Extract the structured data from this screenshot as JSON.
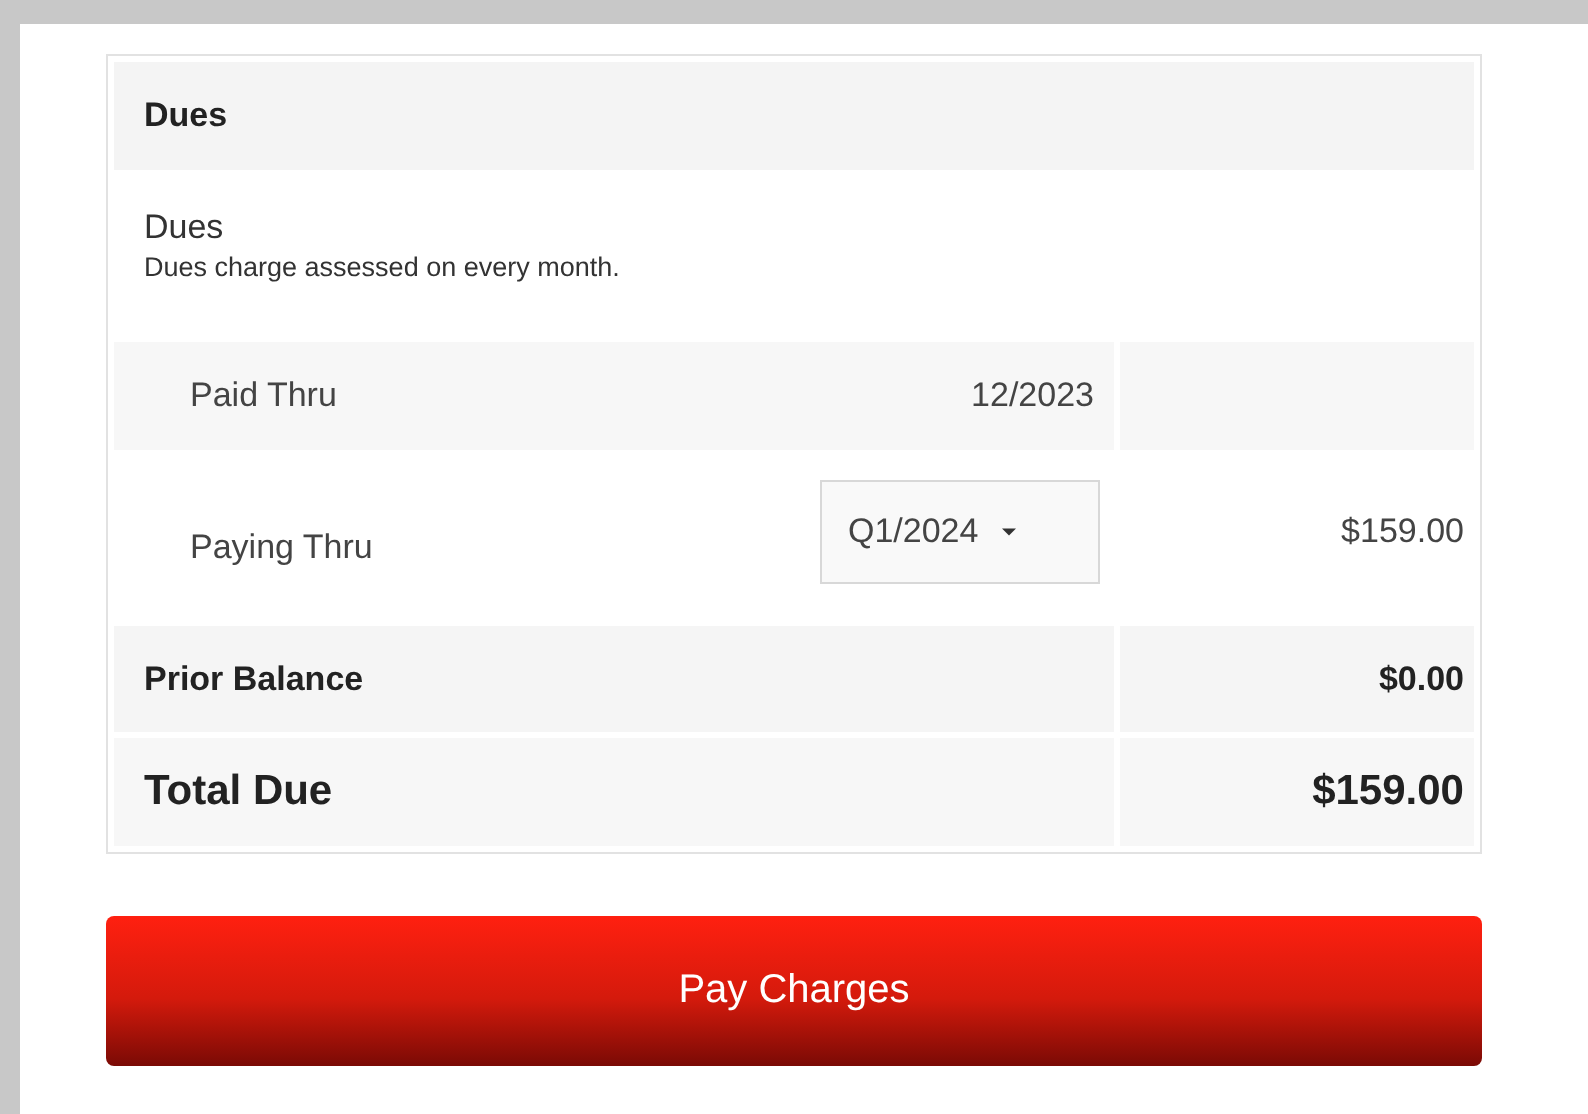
{
  "section": {
    "title": "Dues"
  },
  "charge": {
    "name": "Dues",
    "description": "Dues charge assessed on every month."
  },
  "rows": [
    {
      "kind": "static",
      "label": "Paid Thru",
      "value": "12/2023"
    },
    {
      "kind": "select",
      "label": "Paying Thru",
      "value": "Q1/2024",
      "amount": "$159.00"
    }
  ],
  "totals": [
    {
      "kind": "subtotal",
      "label": "Prior Balance",
      "amount": "$0.00"
    },
    {
      "kind": "grand",
      "label": "Total Due",
      "amount": "$159.00"
    }
  ],
  "button": {
    "label": "Pay Charges"
  }
}
